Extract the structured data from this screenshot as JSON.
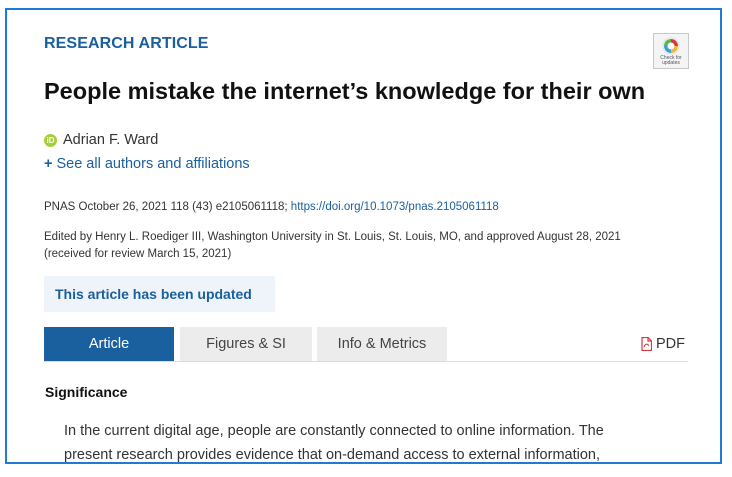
{
  "article": {
    "kicker": "RESEARCH ARTICLE",
    "check_badge": {
      "line1": "Check for",
      "line2": "updates"
    },
    "title": "People mistake the internet’s knowledge for their own",
    "author": {
      "orcid_badge": "iD",
      "name": "Adrian F. Ward"
    },
    "see_all": {
      "plus": "+",
      "label": "See all authors and affiliations"
    },
    "citation": {
      "text": "PNAS October 26, 2021 118 (43) e2105061118;",
      "doi": "https://doi.org/10.1073/pnas.2105061118"
    },
    "edited": {
      "line1": "Edited by Henry L. Roediger III, Washington University in St. Louis, St. Louis, MO, and approved August 28, 2021",
      "line2": "(received for review March 15, 2021)"
    },
    "update_notice": "This article has been updated"
  },
  "tabs": [
    {
      "label": "Article",
      "active": true
    },
    {
      "label": "Figures & SI",
      "active": false
    },
    {
      "label": "Info & Metrics",
      "active": false
    }
  ],
  "pdf": {
    "label": "PDF",
    "icon": "pdf-file-icon"
  },
  "significance": {
    "heading": "Significance",
    "line1": "In the current digital age, people are constantly connected to online information. The",
    "line2": "present research provides evidence that on-demand access to external information,"
  },
  "colors": {
    "frame_border": "#1f7ad6",
    "brand_blue": "#1a5f9e",
    "active_tab_bg": "#1a5f9e",
    "inactive_tab_bg": "#ececec",
    "notice_bg": "#eef4fa",
    "orcid_green": "#a6ce39",
    "pdf_red": "#d9363e"
  }
}
